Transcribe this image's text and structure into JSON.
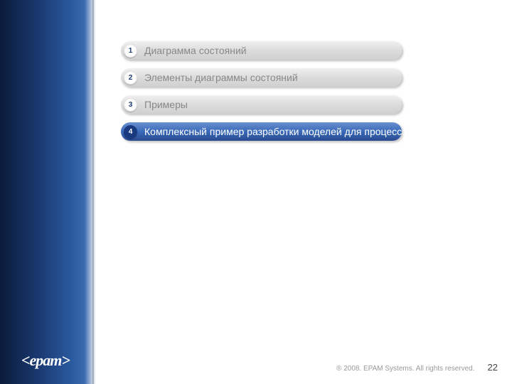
{
  "agenda": {
    "items": [
      {
        "num": "1",
        "label": "Диаграмма состояний",
        "active": false
      },
      {
        "num": "2",
        "label": "Элементы диаграммы состояний",
        "active": false
      },
      {
        "num": "3",
        "label": "Примеры",
        "active": false
      },
      {
        "num": "4",
        "label": "Комплексный пример разработки моделей для  процесса",
        "active": true
      }
    ]
  },
  "logo": "<epam>",
  "footer": {
    "copyright": "® 2008. EPAM Systems. All rights reserved.",
    "page": "22"
  }
}
